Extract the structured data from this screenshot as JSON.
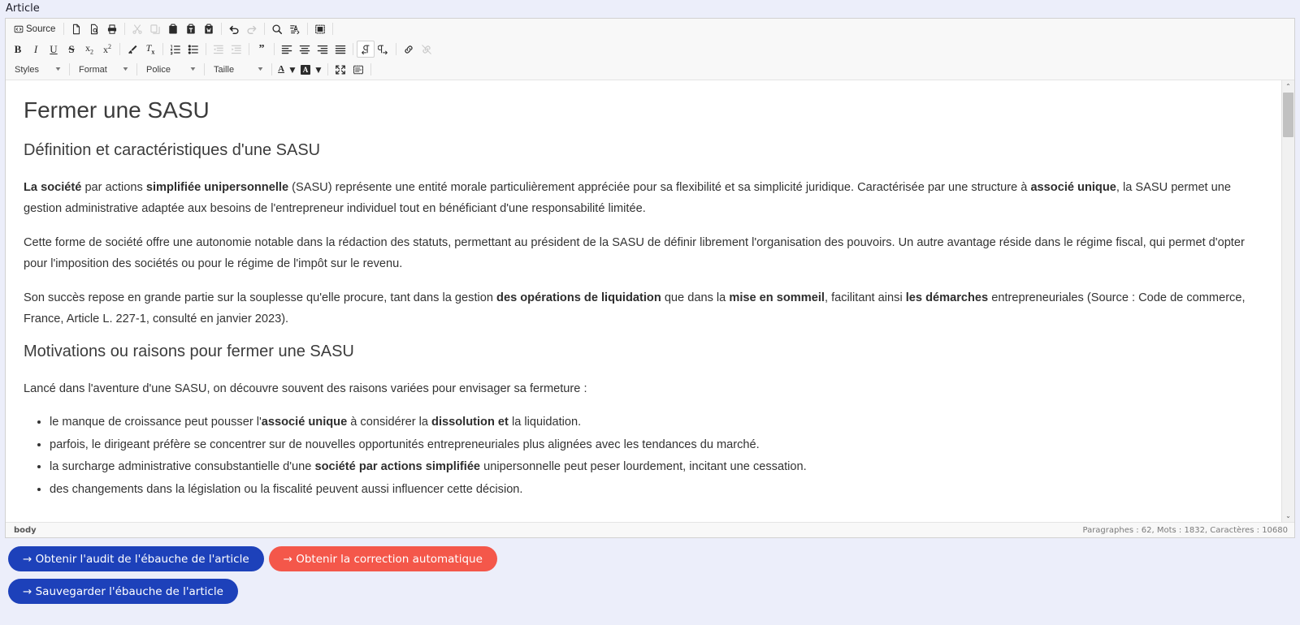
{
  "field": {
    "label": "Article"
  },
  "toolbar": {
    "row1": [
      {
        "name": "source-button",
        "label": "Source",
        "icon": "source-icon",
        "type": "text",
        "disabled": false
      },
      {
        "name": "separator",
        "type": "sep"
      },
      {
        "name": "new-page-button",
        "label": "Nouvelle page",
        "icon": "new-page-icon",
        "type": "icon",
        "disabled": false
      },
      {
        "name": "preview-button",
        "label": "Aperçu",
        "icon": "preview-icon",
        "type": "icon",
        "disabled": false
      },
      {
        "name": "print-button",
        "label": "Imprimer",
        "icon": "print-icon",
        "type": "icon",
        "disabled": false
      },
      {
        "name": "separator",
        "type": "sep"
      },
      {
        "name": "cut-button",
        "label": "Couper",
        "icon": "scissors-icon",
        "type": "icon",
        "disabled": true
      },
      {
        "name": "copy-button",
        "label": "Copier",
        "icon": "copy-icon",
        "type": "icon",
        "disabled": true
      },
      {
        "name": "paste-button",
        "label": "Coller",
        "icon": "paste-icon",
        "type": "icon",
        "disabled": false
      },
      {
        "name": "paste-text-button",
        "label": "Coller comme texte brut",
        "icon": "paste-text-icon",
        "type": "icon",
        "disabled": false
      },
      {
        "name": "paste-word-button",
        "label": "Coller à partir de Word",
        "icon": "paste-word-icon",
        "type": "icon",
        "disabled": false
      },
      {
        "name": "separator",
        "type": "sep"
      },
      {
        "name": "undo-button",
        "label": "Annuler",
        "icon": "undo-icon",
        "type": "icon",
        "disabled": false
      },
      {
        "name": "redo-button",
        "label": "Rétablir",
        "icon": "redo-icon",
        "type": "icon",
        "disabled": true
      },
      {
        "name": "separator",
        "type": "sep"
      },
      {
        "name": "find-button",
        "label": "Rechercher",
        "icon": "magnifier-icon",
        "type": "icon",
        "disabled": false
      },
      {
        "name": "replace-button",
        "label": "Remplacer",
        "icon": "replace-icon",
        "type": "icon",
        "disabled": false
      },
      {
        "name": "separator",
        "type": "sep"
      },
      {
        "name": "select-all-button",
        "label": "Tout sélectionner",
        "icon": "select-all-icon",
        "type": "icon",
        "disabled": false
      },
      {
        "name": "separator",
        "type": "sep"
      }
    ],
    "row2": [
      {
        "name": "bold-button",
        "label": "Gras",
        "icon": "bold-icon",
        "type": "icon",
        "disabled": false
      },
      {
        "name": "italic-button",
        "label": "Italique",
        "icon": "italic-icon",
        "type": "icon",
        "disabled": false
      },
      {
        "name": "underline-button",
        "label": "Souligné",
        "icon": "underline-icon",
        "type": "icon",
        "disabled": false
      },
      {
        "name": "strike-button",
        "label": "Barré",
        "icon": "strikethrough-icon",
        "type": "icon",
        "disabled": false
      },
      {
        "name": "subscript-button",
        "label": "Indice",
        "icon": "subscript-icon",
        "type": "icon",
        "disabled": false
      },
      {
        "name": "superscript-button",
        "label": "Exposant",
        "icon": "superscript-icon",
        "type": "icon",
        "disabled": false
      },
      {
        "name": "separator",
        "type": "sep"
      },
      {
        "name": "copy-formatting-button",
        "label": "Copier le formatage",
        "icon": "paintbrush-icon",
        "type": "icon",
        "disabled": false
      },
      {
        "name": "remove-format-button",
        "label": "Supprimer la mise en forme",
        "icon": "remove-format-icon",
        "type": "icon",
        "disabled": false
      },
      {
        "name": "separator",
        "type": "sep"
      },
      {
        "name": "numbered-list-button",
        "label": "Liste numérotée",
        "icon": "ordered-list-icon",
        "type": "icon",
        "disabled": false
      },
      {
        "name": "bulleted-list-button",
        "label": "Liste à puces",
        "icon": "unordered-list-icon",
        "type": "icon",
        "disabled": false
      },
      {
        "name": "separator",
        "type": "sep"
      },
      {
        "name": "outdent-button",
        "label": "Diminuer le retrait",
        "icon": "outdent-icon",
        "type": "icon",
        "disabled": true
      },
      {
        "name": "indent-button",
        "label": "Augmenter le retrait",
        "icon": "indent-icon",
        "type": "icon",
        "disabled": true
      },
      {
        "name": "separator",
        "type": "sep"
      },
      {
        "name": "blockquote-button",
        "label": "Citation",
        "icon": "blockquote-icon",
        "type": "icon",
        "disabled": false
      },
      {
        "name": "separator",
        "type": "sep"
      },
      {
        "name": "align-left-button",
        "label": "Aligner à gauche",
        "icon": "align-left-icon",
        "type": "icon",
        "disabled": false
      },
      {
        "name": "align-center-button",
        "label": "Centrer",
        "icon": "align-center-icon",
        "type": "icon",
        "disabled": false
      },
      {
        "name": "align-right-button",
        "label": "Aligner à droite",
        "icon": "align-right-icon",
        "type": "icon",
        "disabled": false
      },
      {
        "name": "align-justify-button",
        "label": "Justifier",
        "icon": "align-justify-icon",
        "type": "icon",
        "disabled": false
      },
      {
        "name": "separator",
        "type": "sep"
      },
      {
        "name": "ltr-button",
        "label": "Texte de gauche à droite",
        "icon": "ltr-icon",
        "type": "icon",
        "disabled": false,
        "active": true
      },
      {
        "name": "rtl-button",
        "label": "Texte de droite à gauche",
        "icon": "rtl-icon",
        "type": "icon",
        "disabled": false
      },
      {
        "name": "separator",
        "type": "sep"
      },
      {
        "name": "link-button",
        "label": "Lien",
        "icon": "link-icon",
        "type": "icon",
        "disabled": false
      },
      {
        "name": "unlink-button",
        "label": "Supprimer le lien",
        "icon": "unlink-icon",
        "type": "icon",
        "disabled": true
      }
    ],
    "combos": [
      {
        "name": "styles-select",
        "value": "Styles",
        "width": "w-styles"
      },
      {
        "name": "format-select",
        "value": "Format",
        "width": "w-format"
      },
      {
        "name": "police-select",
        "value": "Police",
        "width": "w-police"
      },
      {
        "name": "taille-select",
        "value": "Taille",
        "width": "w-taille"
      }
    ],
    "row3_icons": [
      {
        "name": "text-color-button",
        "label": "Couleur du texte",
        "icon": "text-color-icon",
        "arrow": true
      },
      {
        "name": "background-color-button",
        "label": "Couleur d'arrière-plan",
        "icon": "bg-color-icon",
        "arrow": true
      },
      {
        "name": "separator",
        "type": "sep"
      },
      {
        "name": "maximize-button",
        "label": "Maximiser",
        "icon": "maximize-icon",
        "arrow": false
      },
      {
        "name": "show-blocks-button",
        "label": "Afficher les blocs",
        "icon": "show-blocks-icon",
        "arrow": false
      },
      {
        "name": "separator",
        "type": "sep"
      }
    ]
  },
  "document": {
    "title": "Fermer une SASU",
    "section1_heading": "Définition et caractéristiques d'une SASU",
    "paragraphs": [
      [
        {
          "t": "La société",
          "b": true
        },
        {
          "t": " par actions ",
          "b": false
        },
        {
          "t": "simplifiée unipersonnelle",
          "b": true
        },
        {
          "t": " (SASU) représente une entité morale particulièrement appréciée pour sa flexibilité et sa simplicité juridique. Caractérisée par une structure à ",
          "b": false
        },
        {
          "t": "associé unique",
          "b": true
        },
        {
          "t": ", la SASU permet une gestion administrative adaptée aux besoins de l'entrepreneur individuel tout en bénéficiant d'une responsabilité limitée.",
          "b": false
        }
      ],
      [
        {
          "t": "Cette forme de société offre une autonomie notable dans la rédaction des statuts, permettant au président de la SASU de définir librement l'organisation des pouvoirs. Un autre avantage réside dans le régime fiscal, qui permet d'opter pour l'imposition des sociétés ou pour le régime de l'impôt sur le revenu.",
          "b": false
        }
      ],
      [
        {
          "t": "Son succès repose en grande partie sur la souplesse qu'elle procure, tant dans la gestion ",
          "b": false
        },
        {
          "t": "des opérations de liquidation",
          "b": true
        },
        {
          "t": " que dans la ",
          "b": false
        },
        {
          "t": "mise en sommeil",
          "b": true
        },
        {
          "t": ", facilitant ainsi ",
          "b": false
        },
        {
          "t": "les démarches",
          "b": true
        },
        {
          "t": " entrepreneuriales (Source : Code de commerce, France, Article L. 227-1, consulté en janvier 2023).",
          "b": false
        }
      ]
    ],
    "section2_heading": "Motivations ou raisons pour fermer une SASU",
    "intro2": [
      {
        "t": "Lancé dans l'aventure d'une SASU, on découvre souvent des raisons variées pour envisager sa fermeture :",
        "b": false
      }
    ],
    "bullets": [
      [
        {
          "t": "le manque de croissance peut pousser l'",
          "b": false
        },
        {
          "t": "associé unique",
          "b": true
        },
        {
          "t": " à considérer la ",
          "b": false
        },
        {
          "t": "dissolution et",
          "b": true
        },
        {
          "t": " la liquidation.",
          "b": false
        }
      ],
      [
        {
          "t": "parfois, le dirigeant préfère se concentrer sur de nouvelles opportunités entrepreneuriales plus alignées avec les tendances du marché.",
          "b": false
        }
      ],
      [
        {
          "t": "la surcharge administrative consubstantielle d'une ",
          "b": false
        },
        {
          "t": "société par actions simplifiée",
          "b": true
        },
        {
          "t": " unipersonnelle peut peser lourdement, incitant une cessation.",
          "b": false
        }
      ],
      [
        {
          "t": "des changements dans la législation ou la fiscalité peuvent aussi influencer cette décision.",
          "b": false
        }
      ]
    ]
  },
  "statusbar": {
    "element_path": "body",
    "counts": "Paragraphes : 62, Mots : 1832, Caractères : 10680"
  },
  "footer": {
    "buttons": [
      {
        "name": "audit-draft-button",
        "label": "→ Obtenir l'audit de l'ébauche de l'article",
        "style": "primary"
      },
      {
        "name": "auto-correction-button",
        "label": "→ Obtenir la correction automatique",
        "style": "danger"
      },
      {
        "name": "save-draft-button",
        "label": "→ Sauvegarder l'ébauche de l'article",
        "style": "primary"
      }
    ]
  },
  "colors": {
    "primary": "#1d41ba",
    "danger": "#f4574a",
    "page_background": "#eceefa",
    "toolbar_background": "#f8f8f8"
  },
  "scrollbar": {
    "up": "⌃",
    "down": "⌄"
  }
}
